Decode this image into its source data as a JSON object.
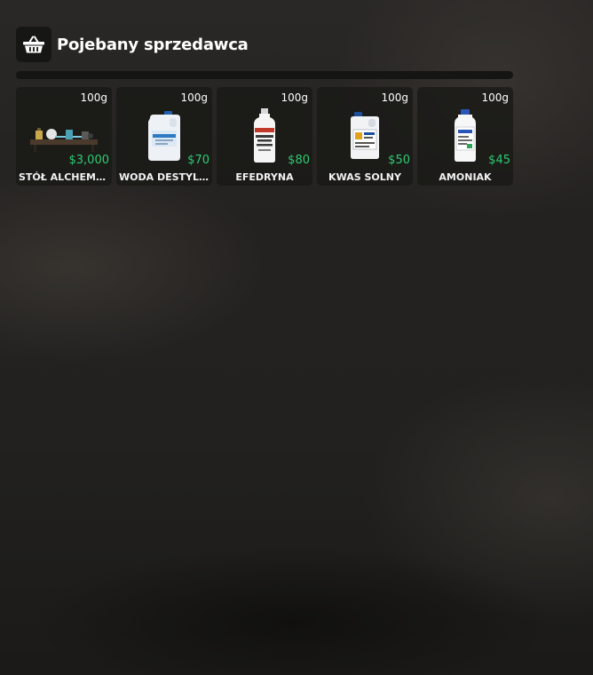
{
  "header": {
    "title": "Pojebany sprzedawca",
    "icon": "basket-icon"
  },
  "progress": {
    "value": 0,
    "fill_color": "#29c46a"
  },
  "items": [
    {
      "name": "STÓŁ ALCHEMI...",
      "weight": "100g",
      "price": "$3,000",
      "image": "alchemy-table-image"
    },
    {
      "name": "WODA DESTYL...",
      "weight": "100g",
      "price": "$70",
      "image": "distilled-water-canister-image"
    },
    {
      "name": "EFEDRYNA",
      "weight": "100g",
      "price": "$80",
      "image": "ephedrine-bottle-image"
    },
    {
      "name": "KWAS SOLNY",
      "weight": "100g",
      "price": "$50",
      "image": "hydrochloric-acid-canister-image"
    },
    {
      "name": "AMONIAK",
      "weight": "100g",
      "price": "$45",
      "image": "ammonia-bottle-image"
    }
  ],
  "colors": {
    "price": "#2ecc71",
    "card_background": "#181816",
    "text": "#ffffff"
  }
}
